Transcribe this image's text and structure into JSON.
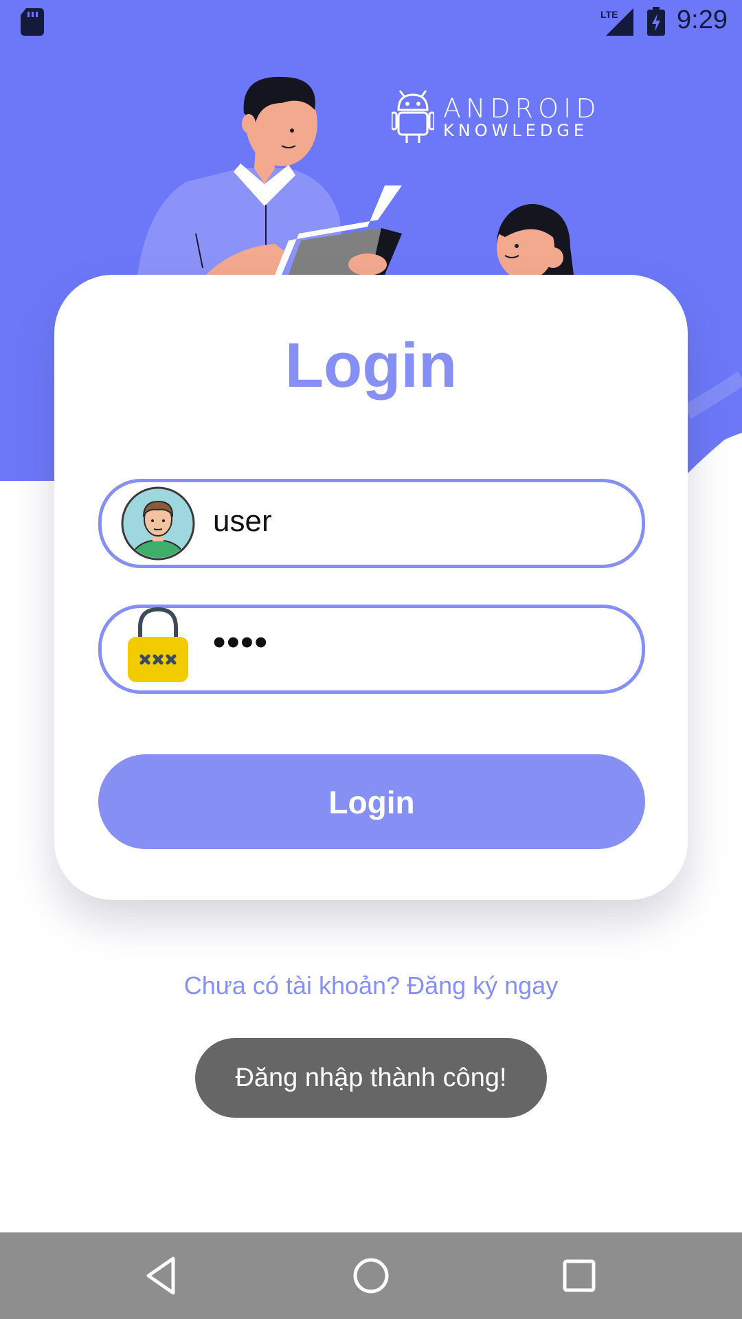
{
  "status_bar": {
    "time": "9:29",
    "network": "LTE",
    "icons": [
      "sd-card-icon",
      "signal-lte-icon",
      "battery-charging-icon"
    ]
  },
  "logo": {
    "line1": "ANDROID",
    "line2": "KNOWLEDGE",
    "icon": "android-robot-icon"
  },
  "card": {
    "title": "Login",
    "username": {
      "value": "user",
      "icon": "user-avatar-icon"
    },
    "password": {
      "value": "••••",
      "icon": "padlock-icon"
    },
    "login_button": "Login"
  },
  "register_link": "Chưa có tài khoản? Đăng ký ngay",
  "toast": "Đăng nhập thành công!",
  "nav_bar": {
    "buttons": [
      "back-icon",
      "home-icon",
      "recents-icon"
    ]
  },
  "colors": {
    "header_bg": "#6c78f8",
    "accent": "#8690f4",
    "toast_bg": "#666666",
    "nav_bg": "#8e8e8e"
  }
}
